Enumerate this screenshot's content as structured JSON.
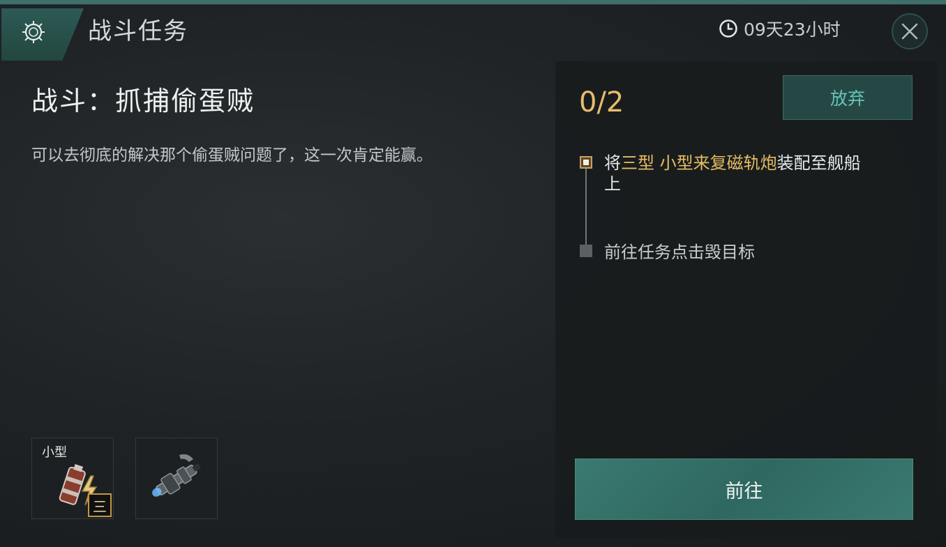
{
  "header": {
    "title": "战斗任务",
    "timer": "09天23小时",
    "icons": {
      "emblem": "mission-emblem-icon",
      "clock": "clock-icon",
      "close": "close-icon"
    }
  },
  "quest": {
    "title": "战斗：抓捕偷蛋贼",
    "description": "可以去彻底的解决那个偷蛋贼问题了，这一次肯定能赢。"
  },
  "rewards": [
    {
      "tag": "小型",
      "tier": "三",
      "icon": "battery-lightning-icon"
    },
    {
      "icon": "railgun-weapon-icon"
    }
  ],
  "objectives": {
    "progress": "0/2",
    "abandon_label": "放弃",
    "steps": [
      {
        "prefix": "将",
        "highlight": "三型 小型来复磁轨炮",
        "suffix": "装配至舰船上",
        "status": "active"
      },
      {
        "text": "前往任务点击毁目标",
        "status": "pending"
      }
    ],
    "go_label": "前往"
  },
  "colors": {
    "accent": "#3a7a70",
    "highlight": "#e8bd63",
    "header_band": "#2d5a55"
  }
}
